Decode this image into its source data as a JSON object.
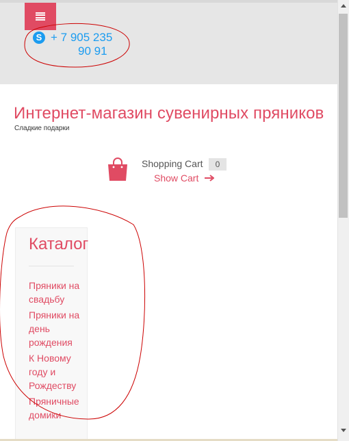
{
  "header": {
    "phone_line1": "+ 7 905 235",
    "phone_line2": "90 91",
    "skype_glyph": "S"
  },
  "site": {
    "title": "Интернет-магазин сувенирных пряников",
    "subtitle": "Сладкие подарки"
  },
  "cart": {
    "title": "Shopping Cart",
    "count": "0",
    "show_label": "Show Cart"
  },
  "catalog": {
    "title": "Каталог",
    "items": [
      "Пряники на свадьбу",
      "Пряники на день рождения",
      "К Новому году и Рождеству",
      "Пряничные домики"
    ]
  },
  "colors": {
    "accent": "#e04b63",
    "skype": "#1b9cf0",
    "topbar_bg": "#e6e6e6",
    "annotation": "#cc0000"
  },
  "icons": [
    "menu-icon",
    "skype-icon",
    "shopping-bag-icon",
    "arrow-right-icon"
  ]
}
